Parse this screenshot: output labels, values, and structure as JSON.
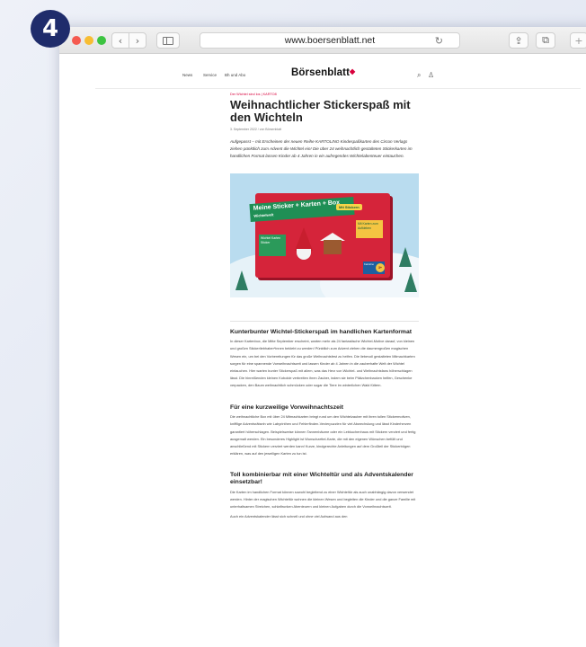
{
  "step": {
    "number": "4"
  },
  "browser": {
    "url": "www.boersenblatt.net",
    "back_glyph": "‹",
    "forward_glyph": "›",
    "reload_glyph": "↻",
    "share_glyph": "⇪",
    "tabs_glyph": "⧉",
    "newtab_glyph": "+"
  },
  "site": {
    "nav": [
      "News",
      "Service",
      "Bh und Abo"
    ],
    "logo": "Börsenblatt",
    "logo_mark": "◆",
    "search_icon": "⌕",
    "user_icon": "♙"
  },
  "article": {
    "kicker": "Der Wichtel sind los | KARTO8",
    "headline": "Weihnachtlicher Stickerspaß mit den Wichteln",
    "meta": "3. September 2022 / von Börsenblatt",
    "lead": "Aufgepasst – mit Erscheinen der neuen Reihe KARTOLINO Kindespaßkarten des Circon Verlags ziehen pünktlich zum Advent die Wichtel ein! Die über 24 weihnachtlich gestalteten Stickerkarten im handlichen Format lassen Kinder ab 4 Jahren in ein aufregendes Wichtelabenteuer eintauchen.",
    "image": {
      "box_title": "Meine Sticker + Karten + Box",
      "box_subtitle": "Wichtelwelt",
      "badge": "Mit Stickern",
      "green_label": "Wichtel Karten Sticker",
      "yellow_label": "Mit Karten zum Aufkleben",
      "cards_label": "Kartolino",
      "price": "3+"
    },
    "sections": [
      {
        "heading": "Kunterbunter Wichtel-Stickerspaß im handlichen Kartenformat",
        "text": "In dieser Kartenbox, die Mitte September erscheint, warten mehr als 24 fantastische Wichtel-Motive darauf, von kleinen und großen Stickerliebhaber*innen beklebt zu werden! Pünktlich zum Advent ziehen die daumengroßen magischen Wesen ein, um bei den Vorbereitungen für das große Weihnachtsfest zu helfen. Die liebevoll gestalteten Mitmachkarten sorgen für eine spannende Vorweihnachtszeit und lassen Kinder ab 4 Jahren in die zauberhafte Welt der Wichtel eintauchen. Hier warten bunter Stickerspaß mit allem, was das Herz von Wichtel- und Weihnachtsfans höherschlagen lässt. Die hinreißenden kleinen Kobolde verbreiten ihren Zauber, indem sie beim Plätzchenbacken helfen, Geschenke verpacken, den Baum weihnachtlich schmücken oder sogar die Tiere im winterlichen Wald füttern."
      },
      {
        "heading": "Für eine kurzweilige Vorweihnachtszeit",
        "text": "Die weihnachtliche Box mit über 24 Mitmachkarten bringt rund um den Wichtelzauber mit ihren tollen Stickermotiven, knifflige Adventsrätseln wie Labyrinthen und Fehlerfinden-Vexierpuzzlen für viel Abwechslung und lässt Kinderherzen garantiert höherschlagen. Beispielsweise können Tannenbäume oder ein Lebkuchenhaus mit Stickern verziert und fertig ausgemalt werden. Ein besonderes Highlight ist Wunschzettel-Karte, die mit den eigenen Wünschen befüllt und anschließend mit Stickern verziert werden kann! Kurze, kindgerechte Anleitungen auf dem Großteil der Stickerbögen erklären, was auf den jeweiligen Karten zu tun ist."
      },
      {
        "heading": "Toll kombinierbar mit einer Wichteltür und als Adventskalender einsetzbar!",
        "text": "Die Karten im handlichen Format können sowohl begleitend zu einer Wichteltür als auch unabhängig davon verwendet werden. Hinter der magischen Wichteltür wohnen die kleinen Wesen und begleiten die Kinder und die ganze Familie mit unterhaltsamen Streichen, schlaftrunken Abenteuern und kleinen Aufgaben durch die Vorweihnachtszeit.",
        "text2": "Auch ein Adventskalender lässt sich schnell und ohne viel Aufwand aus den"
      }
    ]
  }
}
